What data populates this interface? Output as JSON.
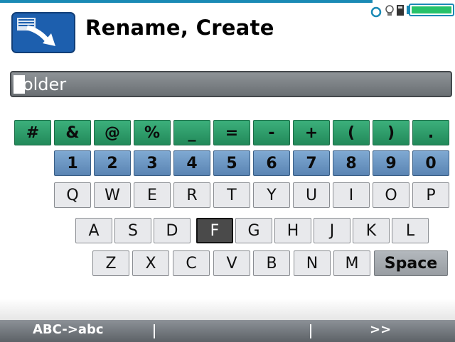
{
  "title": "Rename, Create",
  "input": {
    "value": "Folder"
  },
  "keyboard": {
    "row1": [
      "#",
      "&",
      "@",
      "%",
      "_",
      "=",
      "-",
      "+",
      "(",
      ")",
      "."
    ],
    "row2": [
      "1",
      "2",
      "3",
      "4",
      "5",
      "6",
      "7",
      "8",
      "9",
      "0"
    ],
    "row3": [
      "Q",
      "W",
      "E",
      "R",
      "T",
      "Y",
      "U",
      "I",
      "O",
      "P"
    ],
    "row4": [
      "A",
      "S",
      "D",
      "F",
      "G",
      "H",
      "J",
      "K",
      "L"
    ],
    "row5": [
      "Z",
      "X",
      "C",
      "V",
      "B",
      "N",
      "M"
    ],
    "space_label": "Space",
    "selected_key": "F"
  },
  "softkeys": {
    "left": "ABC->abc",
    "right": ">>"
  },
  "icons": {
    "app": "rename-folder-icon",
    "status": [
      "connection-icon",
      "lightbulb-icon",
      "calculator-icon",
      "battery-icon"
    ]
  },
  "colors": {
    "symbol_keys": "#22895a",
    "number_keys": "#5a84b3",
    "letter_keys": "#e8e9ec",
    "selected_key": "#4a4a4a"
  }
}
